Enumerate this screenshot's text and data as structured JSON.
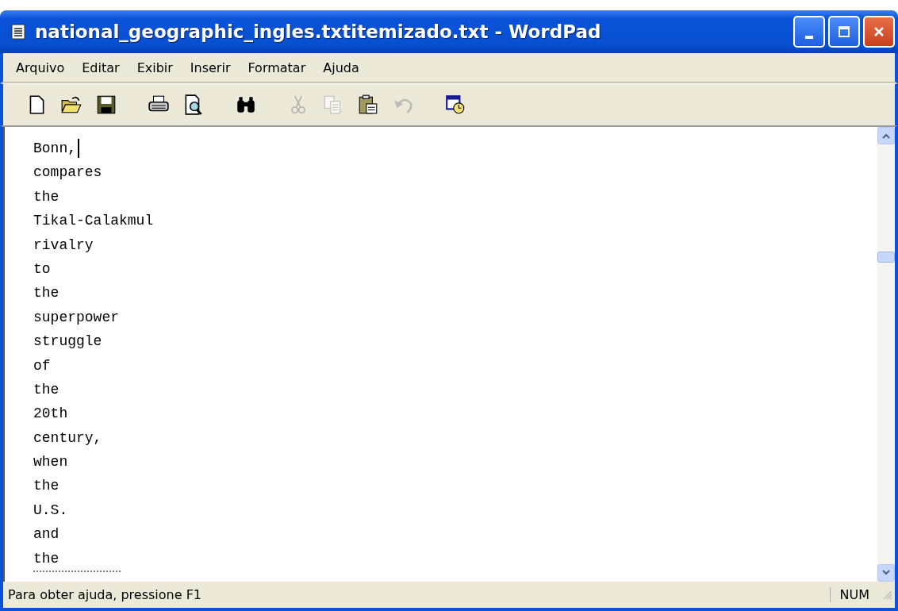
{
  "window": {
    "title": "national_geographic_ingles.txtitemizado.txt - WordPad"
  },
  "menu": [
    "Arquivo",
    "Editar",
    "Exibir",
    "Inserir",
    "Formatar",
    "Ajuda"
  ],
  "toolbar": [
    {
      "kind": "new",
      "disabled": false
    },
    {
      "kind": "open",
      "disabled": false
    },
    {
      "kind": "save",
      "disabled": false
    },
    {
      "kind": "sep"
    },
    {
      "kind": "print",
      "disabled": false
    },
    {
      "kind": "preview",
      "disabled": false
    },
    {
      "kind": "sep"
    },
    {
      "kind": "find",
      "disabled": false
    },
    {
      "kind": "sep"
    },
    {
      "kind": "cut",
      "disabled": true
    },
    {
      "kind": "copy",
      "disabled": true
    },
    {
      "kind": "paste",
      "disabled": false
    },
    {
      "kind": "undo",
      "disabled": true
    },
    {
      "kind": "sep"
    },
    {
      "kind": "datetime",
      "disabled": false
    }
  ],
  "document": {
    "lines": [
      "Bonn,",
      "compares",
      "the",
      "Tikal-Calakmul",
      "rivalry",
      "to",
      "the",
      "superpower",
      "struggle",
      "of",
      "the",
      "20th",
      "century,",
      "when",
      "the",
      "U.S.",
      "and",
      "the"
    ]
  },
  "status_bar": {
    "text": "Para obter ajuda, pressione F1",
    "indicator": "NUM"
  }
}
